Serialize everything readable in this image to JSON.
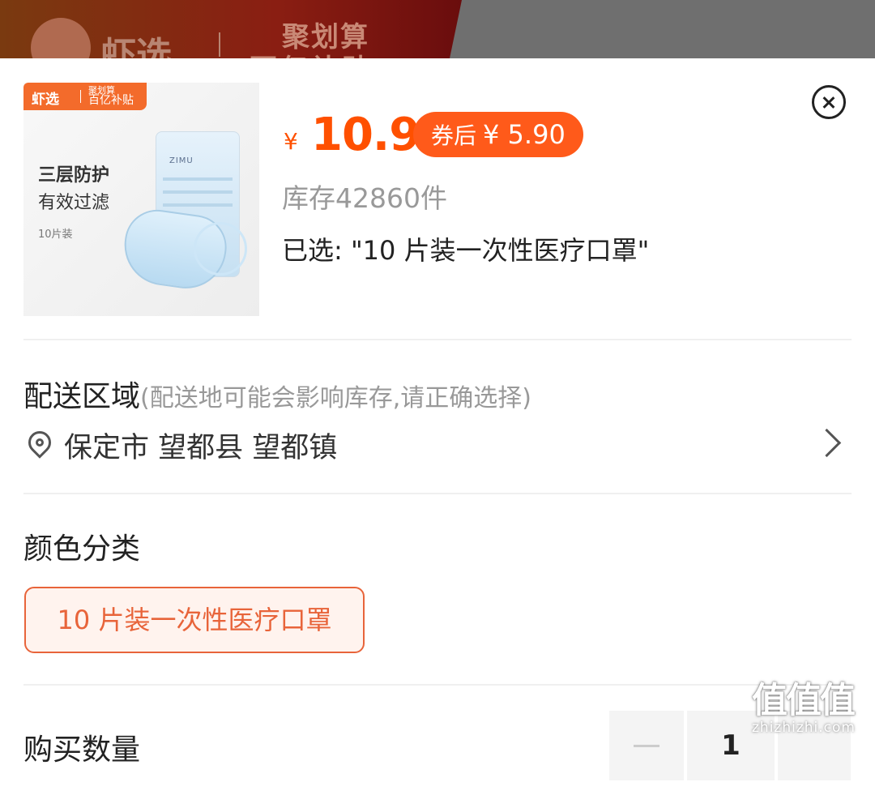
{
  "background": {
    "logo_text": "虾选",
    "brand_top": "聚划算",
    "brand_bottom": "百亿补贴"
  },
  "product": {
    "badge_logo": "虾选",
    "badge_tag_top": "聚划算",
    "badge_tag_bottom": "百亿补贴",
    "image_line1": "三层防护",
    "image_line2": "有效过滤",
    "image_line3": "10片装",
    "pack_brand": "ZIMU",
    "currency": "¥",
    "price": "10.9",
    "coupon_label": "券后",
    "coupon_price": "¥ 5.90",
    "stock": "库存42860件",
    "selected": "已选: \"10 片装一次性医疗口罩\""
  },
  "delivery": {
    "title": "配送区域",
    "hint": "(配送地可能会影响库存,请正确选择)",
    "address": "保定市 望都县 望都镇"
  },
  "options": {
    "title": "颜色分类",
    "items": [
      "10 片装一次性医疗口罩"
    ]
  },
  "quantity": {
    "title": "购买数量",
    "value": "1"
  },
  "watermark": {
    "glyphs": "值值值",
    "url": "zhizhizhi.com"
  },
  "colors": {
    "accent": "#ff5000",
    "option_border": "#e8643a"
  },
  "icons": [
    "close-icon",
    "location-pin-icon",
    "chevron-right-icon",
    "minus-icon"
  ]
}
